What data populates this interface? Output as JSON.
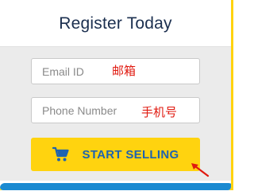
{
  "form": {
    "title": "Register Today",
    "email_placeholder": "Email ID",
    "phone_placeholder": "Phone Number",
    "submit_label": "START SELLING"
  },
  "annotations": {
    "email_note": "邮箱",
    "phone_note": "手机号"
  },
  "icons": {
    "cart": "shopping-cart-icon",
    "pointer": "red-arrow-icon"
  },
  "colors": {
    "accent": "#ffd30f",
    "title": "#1b2f4f",
    "cta_text": "#1d63b0",
    "annotation": "#e0190f",
    "background": "#ebebeb",
    "footer_blue": "#1b8ad1"
  }
}
